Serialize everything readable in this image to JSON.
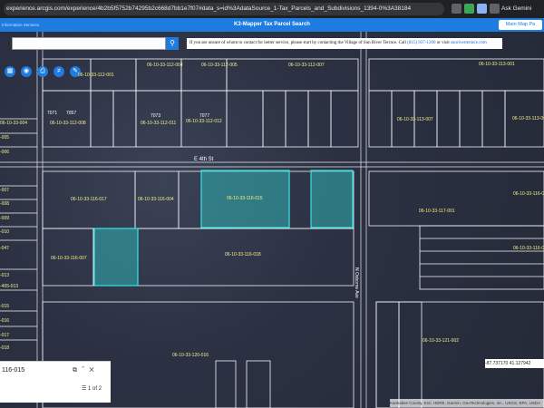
{
  "browser": {
    "url": "experience.arcgis.com/experience/4b2b5f5752b74295b2c668d7bb1e7f07#data_s=id%3AdataSource_1-Tax_Parcels_and_Subdivisions_1394-0%3A38184",
    "ask_gemini": "Ask Gemini"
  },
  "app": {
    "left_text": "Information Services",
    "title": "K3-Mapper Tax Parcel Search",
    "main_page_button": "Main Map Pa"
  },
  "notice": {
    "text": "If you are unsure of whom to contact for better service, please start by contacting the Village of Sun River Terrace. Call",
    "phone": "(815) 937-1200",
    "or_visit": "or visit",
    "site": "sunriverterrace.com"
  },
  "streets": {
    "e_street": "E 4th St",
    "n_street": "N Osborne Ave"
  },
  "parcels": [
    {
      "id": "06-10-33-112-001"
    },
    {
      "id": "06-10-33-112-004"
    },
    {
      "id": "06-10-33-112-005"
    },
    {
      "id": "06-10-33-112-007"
    },
    {
      "id": "06-10-33-113-001"
    },
    {
      "id": "06-10-33-112-008"
    },
    {
      "id": "06-10-33-112-011"
    },
    {
      "id": "06-10-33-112-012"
    },
    {
      "id": "06-10-33-113-007"
    },
    {
      "id": "06-10-33-113-00"
    },
    {
      "id": "06-10-33-116-017"
    },
    {
      "id": "06-10-33-116-004"
    },
    {
      "id": "06-10-33-116-015"
    },
    {
      "id": "06-10-33-117-001"
    },
    {
      "id": "06-10-33-116-007"
    },
    {
      "id": "06-10-33-116-018"
    },
    {
      "id": "06-10-33-120-016"
    },
    {
      "id": "06-10-33-121-002"
    },
    {
      "id": "06-10-33-116-01"
    },
    {
      "id": "06-10-33-116-00"
    }
  ],
  "side_ids": [
    "06-10-33-004",
    "-005",
    "-006",
    "-007",
    "-008",
    "-009",
    "-010",
    "-047",
    "-013",
    "-405-013",
    "-015",
    "-016",
    "-017",
    "-018"
  ],
  "house_numbers": [
    "7071",
    "7057",
    "7073",
    "7077"
  ],
  "popup": {
    "title": "116-015",
    "page": "1 of 2"
  },
  "coords": "-87.737170 41.127942",
  "attribution": "Kankakee County, Esri, HERE, Garmin, GeoTechnologies, Inc., USGS, EPA, USDA"
}
